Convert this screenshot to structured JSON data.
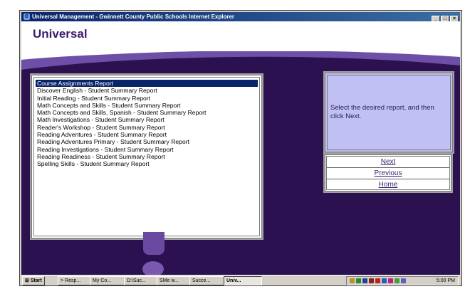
{
  "window": {
    "title": "Universal Management - Gwinnett County Public Schools Internet Explorer",
    "buttons": [
      "_",
      "□",
      "×"
    ]
  },
  "header": {
    "title": "Universal"
  },
  "reports": {
    "items": [
      "Course Assignments Report",
      "Discover English - Student Summary Report",
      "Initial Reading - Student Summary Report",
      "Math Concepts and Skills - Student Summary Report",
      "Math Concepts and Skills, Spanish - Student Summary Report",
      "Math Investigations - Student Summary Report",
      "Reader's Workshop - Student Summary Report",
      "Reading Adventures - Student Summary Report",
      "Reading Adventures Primary - Student Summary Report",
      "Reading Investigations - Student Summary Report",
      "Reading Readiness - Student Summary Report",
      "Spelling Skills - Student Summary Report"
    ],
    "selected_index": 0
  },
  "instructions": {
    "text": "Select the desired report, and then click Next."
  },
  "nav": {
    "next": "Next",
    "previous": "Previous",
    "home": "Home"
  },
  "taskbar": {
    "start": "Start",
    "tasks": [
      "> Resp...",
      "My Co...",
      "D:\\Suc...",
      "SMe w...",
      "Succe...",
      "Univ..."
    ],
    "active_task_index": 5,
    "clock": "5:00 PM",
    "tray_icon_colors": [
      "#c09020",
      "#2a8a2a",
      "#2040a0",
      "#8a2020",
      "#c02020",
      "#2060c0",
      "#c02080",
      "#40a040",
      "#6060c0"
    ]
  },
  "colors": {
    "background": "#2b1150",
    "header_text": "#3c1a6e",
    "info_panel": "#c0c0f4",
    "selection": "#0a246a"
  }
}
